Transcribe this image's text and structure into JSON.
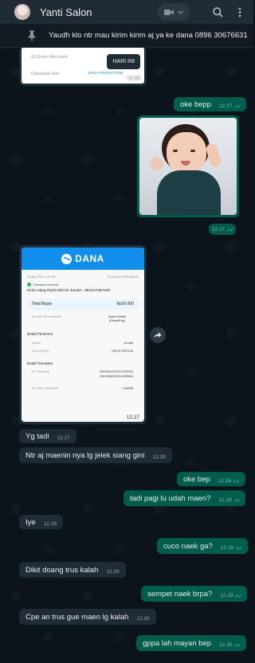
{
  "header": {
    "contact_name": "Yanti Salon"
  },
  "pinned": {
    "text": "Yaudh klo ntr mau kirim kirim aj ya ke dana 0896 30676631"
  },
  "top_receipt": {
    "id_order_label": "ID Order Merchant",
    "brand_line": "Dananilah dari",
    "protection": "DANA PROTECTION",
    "badge": "HARI INI",
    "time": "12.25"
  },
  "messages": [
    {
      "dir": "out",
      "text": "oke bepp",
      "time": "12.27"
    },
    {
      "dir": "out",
      "type": "photo",
      "time": "12.27"
    },
    {
      "dir": "out",
      "text": "oke bep",
      "time": "12.28"
    },
    {
      "dir": "out",
      "text": "tadi pagi lu udah maen?",
      "time": "12.28"
    },
    {
      "dir": "out",
      "text": "cuco naek ga?",
      "time": "12.28"
    },
    {
      "dir": "out",
      "text": "sempet naek brpa?",
      "time": "12.29"
    },
    {
      "dir": "out",
      "text": "gppa lah mayan bep",
      "time": "12.30"
    }
  ],
  "incoming": [
    {
      "text": "Yg tadi",
      "time": "12.27"
    },
    {
      "text": "Ntr aj maenin nya lg jelek siang gini",
      "time": "12.28"
    },
    {
      "text": "Iye",
      "time": "12.28"
    },
    {
      "text": "Dikit doang trus kalah",
      "time": "12.29"
    },
    {
      "text": "Cpe an trus gue maen lg kalah",
      "time": "12.30"
    }
  ],
  "dana_receipt": {
    "logo": "DANA",
    "date": "13 Apr 2023 • 09:46",
    "id_dana": "ID DANA 0896•••6631",
    "status": "Transaksi berhasil",
    "title": "Kirim Uang Rp20.000 ke Jumati - 082127367246",
    "total_label": "Total Bayar",
    "total_value": "Rp20.000",
    "method_label": "Metode Pembayaran",
    "method_value": "Saldo DANA (SmartPay)",
    "recipient_header": "Detail Penerima",
    "name_label": "Nama",
    "name_value": "Jumati",
    "account_label": "Akun DANA",
    "account_value": "082127367246",
    "txn_header": "Detail Transaksi",
    "txn_id_label": "ID Transaksi",
    "txn_id_value": "2023041310121420010 1031669022021999594",
    "merchant_label": "ID Order Merchant",
    "merchant_value": "•••a536",
    "time": "12.27"
  },
  "colors": {
    "chat_bg": "#0b141a",
    "incoming_bubble": "#202c33",
    "outgoing_bubble": "#005c4b",
    "read_ticks": "#53bdeb",
    "dana_blue": "#118eea"
  },
  "icons": [
    "video-call-icon",
    "chevron-down-icon",
    "search-icon",
    "menu-icon",
    "pin-icon",
    "forward-icon",
    "double-check-icon"
  ]
}
